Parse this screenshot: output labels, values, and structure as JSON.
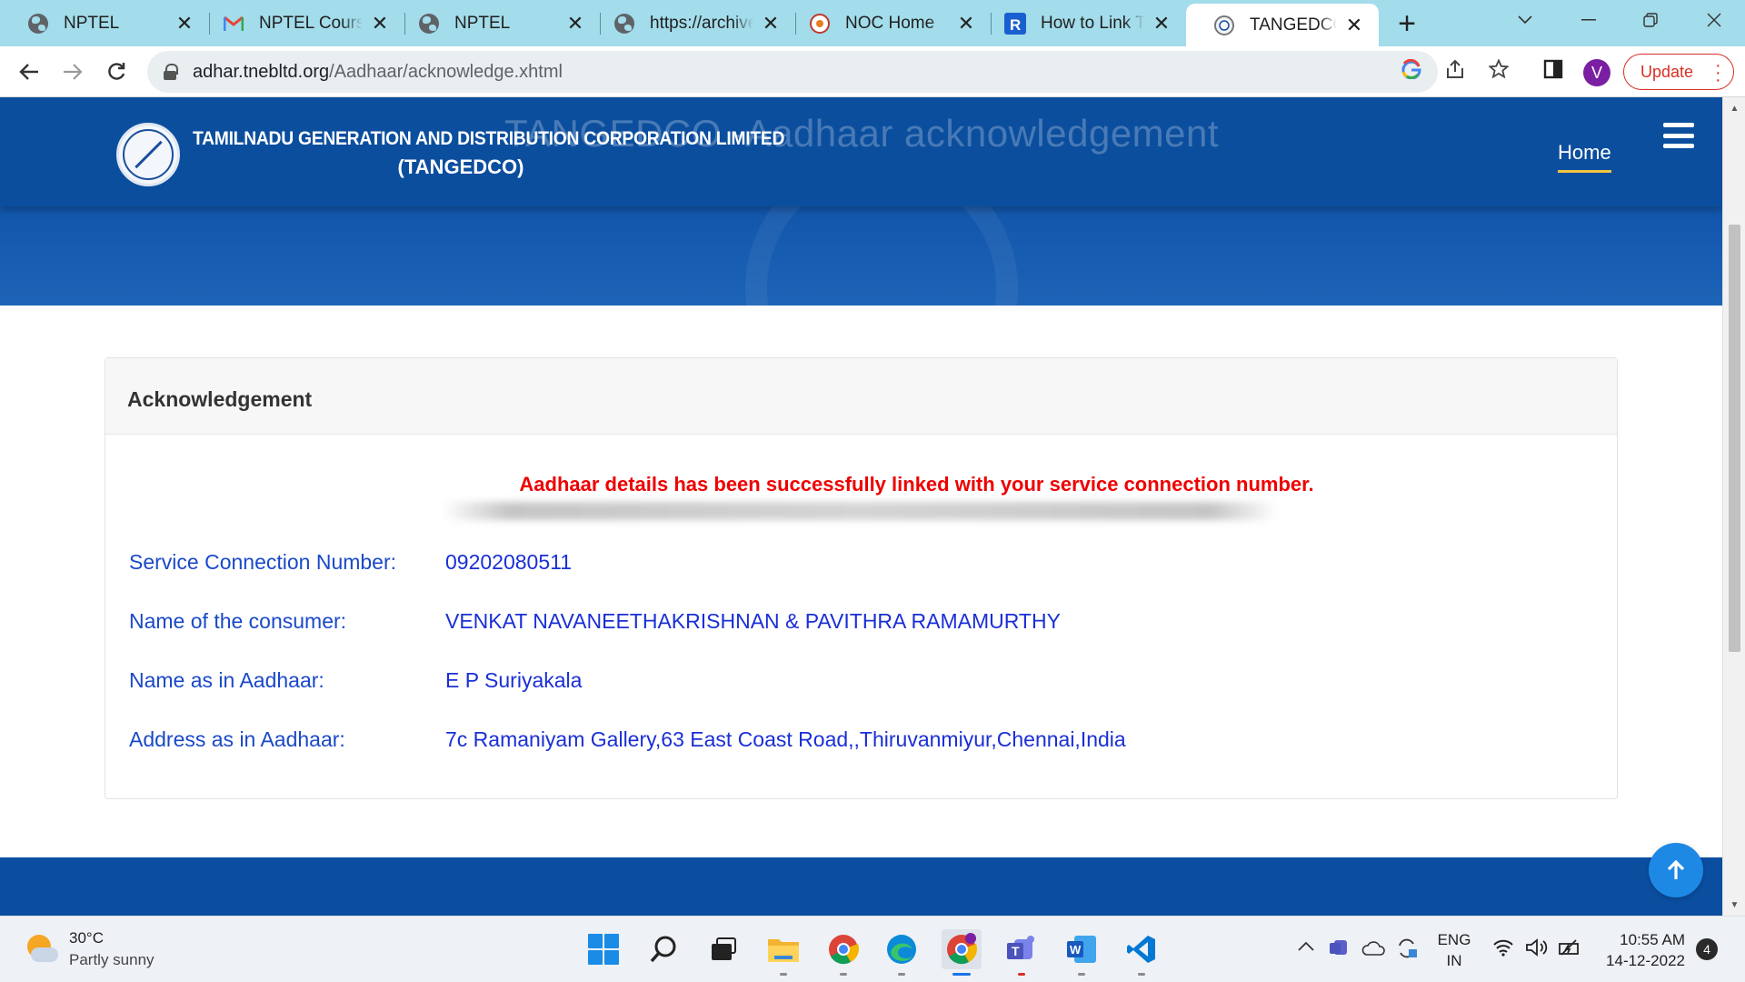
{
  "browser": {
    "tabs": [
      {
        "label": "NPTEL",
        "favicon": "globe-icon"
      },
      {
        "label": "NPTEL Course",
        "favicon": "gmail-icon"
      },
      {
        "label": "NPTEL",
        "favicon": "globe-icon"
      },
      {
        "label": "https://archive.",
        "favicon": "globe-icon"
      },
      {
        "label": "NOC Home",
        "favicon": "noc-logo-icon"
      },
      {
        "label": "How to Link TN",
        "favicon": "r-logo-icon"
      },
      {
        "label": "TANGEDCO AA",
        "favicon": "tangedco-logo-icon",
        "active": true
      }
    ],
    "url_host": "adhar.tnebltd.org",
    "url_path": "/Aadhaar/acknowledge.xhtml",
    "profile_initial": "V",
    "update_label": "Update",
    "accent_update": "#d93025"
  },
  "site": {
    "brand_line1": "TAMILNADU GENERATION AND DISTRIBUTION CORPORATION LIMITED",
    "brand_line2": "(TANGEDCO)",
    "hero_title": "TANGEDCO -Aadhaar acknowledgement",
    "nav_home": "Home",
    "header_color": "#0b4e9e"
  },
  "ack": {
    "heading": "Acknowledgement",
    "success_message": "Aadhaar details has been successfully linked with your service connection number.",
    "fields": [
      {
        "label": "Service Connection Number:",
        "value": "09202080511"
      },
      {
        "label": "Name of the consumer:",
        "value": "VENKAT NAVANEETHAKRISHNAN & PAVITHRA RAMAMURTHY"
      },
      {
        "label": "Name as in Aadhaar:",
        "value": "E P Suriyakala"
      },
      {
        "label": "Address as in Aadhaar:",
        "value": "7c Ramaniyam Gallery,63 East Coast Road,,Thiruvanmiyur,Chennai,India"
      }
    ],
    "success_color": "#ee0000",
    "field_color": "#1a49c8"
  },
  "taskbar": {
    "temperature": "30°C",
    "weather": "Partly sunny",
    "lang_line1": "ENG",
    "lang_line2": "IN",
    "time": "10:55 AM",
    "date": "14-12-2022",
    "notifications": "4"
  }
}
